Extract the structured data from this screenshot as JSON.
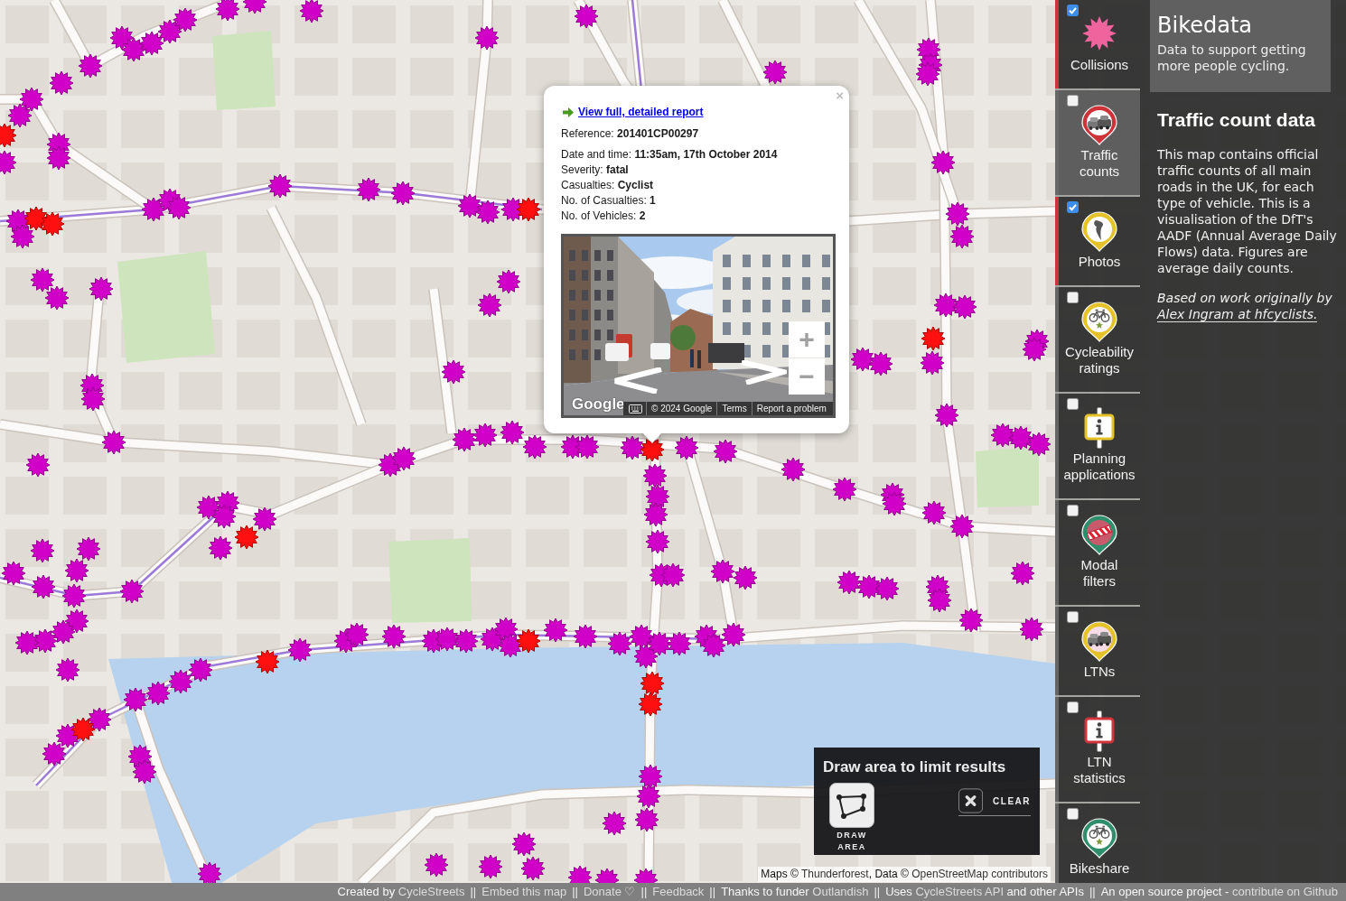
{
  "map": {
    "attribution": [
      {
        "kind": "plain",
        "text": "Maps © "
      },
      {
        "kind": "link",
        "text": "Thunderforest"
      },
      {
        "kind": "plain",
        "text": ", Data © "
      },
      {
        "kind": "link",
        "text": "OpenStreetMap contributors"
      }
    ]
  },
  "popup": {
    "close": "×",
    "report_link": "View full, detailed report",
    "reference": "Reference: **201401CP00297**",
    "details": [
      "Date and time: **11:35am, 17th October 2014**",
      "Severity: **fatal**",
      "Casualties: **Cyclist**",
      "No. of Casualties: **1**",
      "No. of Vehicles: **2**"
    ],
    "street_view": {
      "zoom_in": "+",
      "zoom_out": "−",
      "logo": "Google",
      "copyright": "© 2024 Google",
      "links": [
        "Terms",
        "Report a problem"
      ]
    }
  },
  "draw_area": {
    "title": "Draw area to limit results",
    "draw_button": "DRAW AREA",
    "clear_button": "CLEAR"
  },
  "sidebar": {
    "layers": [
      {
        "kind": "collisions",
        "label": "Collisions",
        "checked": true,
        "selected": false
      },
      {
        "kind": "traffic_counts",
        "label": "Traffic counts",
        "checked": false,
        "selected": true
      },
      {
        "kind": "photos",
        "label": "Photos",
        "checked": true,
        "selected": false
      },
      {
        "kind": "cycleability",
        "label": "Cycleability ratings",
        "checked": false,
        "selected": false
      },
      {
        "kind": "planning",
        "label": "Planning applications",
        "checked": false,
        "selected": false
      },
      {
        "kind": "modal_filters",
        "label": "Modal filters",
        "checked": false,
        "selected": false
      },
      {
        "kind": "ltns",
        "label": "LTNs",
        "checked": false,
        "selected": false
      },
      {
        "kind": "ltn_statistics",
        "label": "LTN statistics",
        "checked": false,
        "selected": false
      },
      {
        "kind": "bikeshare",
        "label": "Bikeshare",
        "checked": false,
        "selected": false
      }
    ]
  },
  "info_panel": {
    "brand": {
      "title": "Bikedata",
      "tagline": "Data to support getting more people cycling."
    },
    "heading": "Traffic count data",
    "description": "This map contains official traffic counts of all main roads in the UK, for each type of vehicle. This is a visualisation of the DfT's AADF (Annual Average Daily Flows) data. Figures are average daily counts.",
    "credit": [
      {
        "kind": "plain",
        "text": "Based on work originally by "
      },
      {
        "kind": "link",
        "text": "Alex Ingram at hfcyclists."
      }
    ]
  },
  "footer": {
    "items": [
      {
        "kind": "text",
        "parts": [
          {
            "kind": "plain",
            "text": "Created by "
          },
          {
            "kind": "link",
            "text": "CycleStreets"
          }
        ]
      },
      {
        "kind": "separator",
        "text": "||"
      },
      {
        "kind": "text",
        "parts": [
          {
            "kind": "link",
            "text": "Embed this map"
          }
        ]
      },
      {
        "kind": "separator",
        "text": "||"
      },
      {
        "kind": "text",
        "parts": [
          {
            "kind": "link",
            "text": "Donate ♡"
          }
        ]
      },
      {
        "kind": "separator",
        "text": "||"
      },
      {
        "kind": "text",
        "parts": [
          {
            "kind": "link",
            "text": "Feedback"
          }
        ]
      },
      {
        "kind": "separator",
        "text": "||"
      },
      {
        "kind": "text",
        "parts": [
          {
            "kind": "plain",
            "text": "Thanks to funder "
          },
          {
            "kind": "link",
            "text": "Outlandish"
          }
        ]
      },
      {
        "kind": "separator",
        "text": "||"
      },
      {
        "kind": "text",
        "parts": [
          {
            "kind": "plain",
            "text": "Uses "
          },
          {
            "kind": "link",
            "text": "CycleStreets API"
          },
          {
            "kind": "plain",
            "text": " and other APIs"
          }
        ]
      },
      {
        "kind": "separator",
        "text": "||"
      },
      {
        "kind": "text",
        "parts": [
          {
            "kind": "plain",
            "text": "An open source project - "
          },
          {
            "kind": "link",
            "text": "contribute on Github"
          }
        ]
      }
    ]
  }
}
